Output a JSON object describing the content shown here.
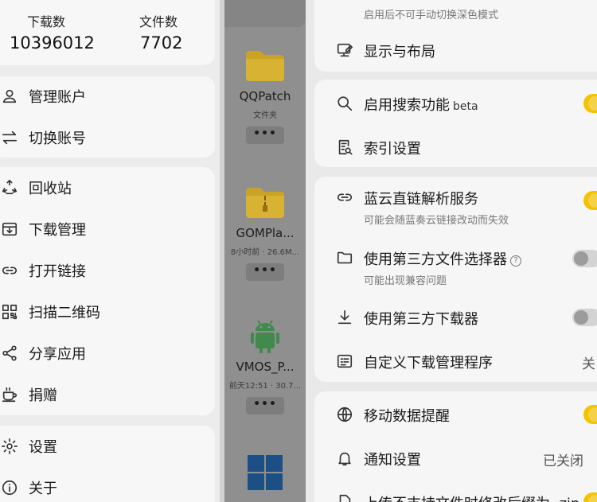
{
  "drawer": {
    "stats": [
      {
        "label": "下载数",
        "value": "10396012"
      },
      {
        "label": "文件数",
        "value": "7702"
      }
    ],
    "account_items": [
      {
        "label": "管理账户",
        "icon": "person-icon"
      },
      {
        "label": "切换账号",
        "icon": "swap-icon"
      }
    ],
    "tool_items": [
      {
        "label": "回收站",
        "icon": "recycle-icon"
      },
      {
        "label": "下载管理",
        "icon": "download-box-icon"
      },
      {
        "label": "打开链接",
        "icon": "link-icon"
      },
      {
        "label": "扫描二维码",
        "icon": "qrcode-icon"
      },
      {
        "label": "分享应用",
        "icon": "share-icon"
      },
      {
        "label": "捐赠",
        "icon": "coffee-icon"
      }
    ],
    "bottom_items": [
      {
        "label": "设置",
        "icon": "gear-icon"
      },
      {
        "label": "关于",
        "icon": "info-icon"
      }
    ]
  },
  "files": [
    {
      "name": "QQPatch",
      "meta": "文件夹",
      "more": "•••",
      "icon": "folder-icon"
    },
    {
      "name": "GOMPla...",
      "meta": "8小时前 · 26.6M...",
      "more": "•••",
      "icon": "zip-folder-icon"
    },
    {
      "name": "VMOS_P...",
      "meta": "前天12:51 · 30.7...",
      "more": "•••",
      "icon": "android-icon"
    }
  ],
  "settings": {
    "dark_mode_sub": "启用后不可手动切换深色模式",
    "display_layout": "显示与布局",
    "search": {
      "title": "启用搜索功能",
      "badge": "beta",
      "enabled": true
    },
    "index_settings": "索引设置",
    "lanzou": {
      "title": "蓝云直链解析服务",
      "sub": "可能会随蓝奏云链接改动而失效",
      "enabled": true
    },
    "third_party_picker": {
      "title": "使用第三方文件选择器",
      "help": "?",
      "sub": "可能出现兼容问题",
      "enabled": false
    },
    "third_party_downloader": {
      "title": "使用第三方下载器",
      "enabled": false
    },
    "custom_download_manager": {
      "title": "自定义下载管理程序",
      "value": "关"
    },
    "mobile_data_alert": {
      "title": "移动数据提醒",
      "enabled": true
    },
    "notification_settings": {
      "title": "通知设置",
      "value": "已关闭"
    },
    "upload_rename": {
      "title": "上传不支持文件时修改后缀为 .zip",
      "enabled": true
    }
  },
  "colors": {
    "accent": "#f4c300",
    "folder": "#f2b705",
    "android": "#3ddc84",
    "windows": "#0a64c8"
  }
}
